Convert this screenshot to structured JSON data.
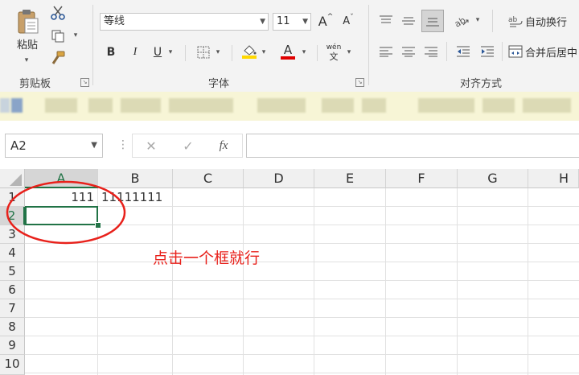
{
  "clipboard": {
    "paste_label": "粘贴",
    "group_label": "剪贴板"
  },
  "font": {
    "name": "等线",
    "size": "11",
    "bold": "B",
    "italic": "I",
    "underline": "U",
    "group_label": "字体",
    "grow": "A",
    "shrink": "A",
    "phonetic_top": "wén",
    "phonetic_bottom": "文"
  },
  "alignment": {
    "wrap_label": "自动换行",
    "merge_label": "合并后居中",
    "group_label": "对齐方式"
  },
  "name_box": {
    "value": "A2"
  },
  "formula_bar": {
    "fx": "fx",
    "value": ""
  },
  "columns": [
    "A",
    "B",
    "C",
    "D",
    "E",
    "F",
    "G",
    "H"
  ],
  "rows": [
    "1",
    "2",
    "3",
    "4",
    "5",
    "6",
    "7",
    "8",
    "9",
    "10"
  ],
  "cells": {
    "A1": "111",
    "B1": "11111111"
  },
  "annotation": {
    "text": "点击一个框就行"
  },
  "colors": {
    "selection": "#217346",
    "annotation": "#e8211b",
    "ribbon_bg": "#f3f3f3"
  }
}
